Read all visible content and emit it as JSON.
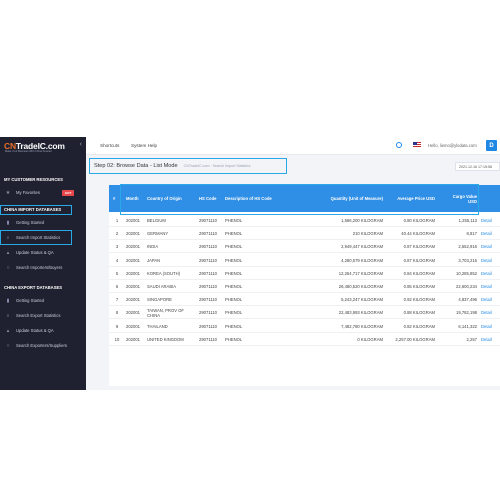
{
  "logo": {
    "main_a": "CN",
    "main_b": "TradeIC",
    "main_c": ".com",
    "sub": "Make Your Business With China Smarter",
    "collapse": "‹"
  },
  "sidebar": {
    "resources_head": "MY CUSTOMER RESOURCES",
    "favorites": "My Favorites",
    "hot_badge": "HOT",
    "import_head": "CHINA IMPORT DATABASES",
    "import_items": [
      "Getting Started",
      "Search Import Statistics",
      "Update Status & QA",
      "Search Importers/Buyers"
    ],
    "export_head": "CHINA EXPORT DATABASES",
    "export_items": [
      "Getting Started",
      "Search Export Statistics",
      "Update Status & QA",
      "Search Exporters/Suppliers"
    ]
  },
  "topbar": {
    "shortcuts": "Shortcuts",
    "system_help": "System Help",
    "hello": "Hello, liemo@ylodata.com",
    "avatar": "D"
  },
  "page": {
    "step_title": "Step 02: Browse Data - List Mode",
    "breadcrumb": "CNTradeIC.com · Search Import Statistics",
    "date": "2021.12.16 17:15:58"
  },
  "table": {
    "headers": {
      "num": "#",
      "month": "Month",
      "country": "Country of Origin",
      "hs": "HS Code",
      "desc": "Description of HS Code",
      "qty": "Quantity (Unit of Measure)",
      "price": "Average Price USD",
      "value": "Cargo Value USD"
    },
    "rows": [
      {
        "num": "1",
        "month": "202001",
        "country": "BELGIUM",
        "hs": "29071110",
        "desc": "PHENOL",
        "qty": "1,566,200 KILOGRAM",
        "price": "0.80 KILOGRAM",
        "value": "1,255,113",
        "detail": "Detail"
      },
      {
        "num": "2",
        "month": "202001",
        "country": "GERMANY",
        "hs": "29071110",
        "desc": "PHENOL",
        "qty": "210 KILOGRAM",
        "price": "40.44 KILOGRAM",
        "value": "8,817",
        "detail": "Detail"
      },
      {
        "num": "3",
        "month": "202001",
        "country": "INDIA",
        "hs": "29071110",
        "desc": "PHENOL",
        "qty": "2,949,447 KILOGRAM",
        "price": "0.87 KILOGRAM",
        "value": "2,552,916",
        "detail": "Detail"
      },
      {
        "num": "4",
        "month": "202001",
        "country": "JAPAN",
        "hs": "29071110",
        "desc": "PHENOL",
        "qty": "4,280,579 KILOGRAM",
        "price": "0.87 KILOGRAM",
        "value": "3,703,215",
        "detail": "Detail"
      },
      {
        "num": "5",
        "month": "202001",
        "country": "KOREA (SOUTH)",
        "hs": "29071110",
        "desc": "PHENOL",
        "qty": "12,264,717 KILOGRAM",
        "price": "0.84 KILOGRAM",
        "value": "10,285,852",
        "detail": "Detail"
      },
      {
        "num": "6",
        "month": "202001",
        "country": "SAUDI ARABIA",
        "hs": "29071110",
        "desc": "PHENOL",
        "qty": "26,480,520 KILOGRAM",
        "price": "0.85 KILOGRAM",
        "value": "22,600,234",
        "detail": "Detail"
      },
      {
        "num": "7",
        "month": "202001",
        "country": "SINGAPORE",
        "hs": "29071110",
        "desc": "PHENOL",
        "qty": "5,243,247 KILOGRAM",
        "price": "0.92 KILOGRAM",
        "value": "4,837,496",
        "detail": "Detail"
      },
      {
        "num": "8",
        "month": "202001",
        "country": "TAIWAN, PROV OF CHINA",
        "hs": "29071110",
        "desc": "PHENOL",
        "qty": "22,483,993 KILOGRAM",
        "price": "0.88 KILOGRAM",
        "value": "19,782,198",
        "detail": "Detail"
      },
      {
        "num": "9",
        "month": "202001",
        "country": "THAILAND",
        "hs": "29071110",
        "desc": "PHENOL",
        "qty": "7,482,780 KILOGRAM",
        "price": "0.82 KILOGRAM",
        "value": "6,141,322",
        "detail": "Detail"
      },
      {
        "num": "10",
        "month": "202001",
        "country": "UNITED KINGDOM",
        "hs": "29071110",
        "desc": "PHENOL",
        "qty": "0 KILOGRAM",
        "price": "2,257.00 KILOGRAM",
        "value": "2,257",
        "detail": "Detail"
      }
    ]
  },
  "colors": {
    "sidebar_bg": "#1f2130",
    "header_blue": "#2f8ee5",
    "highlight": "#2aa9e8",
    "link": "#1e88e5",
    "hot": "#e8484d"
  }
}
